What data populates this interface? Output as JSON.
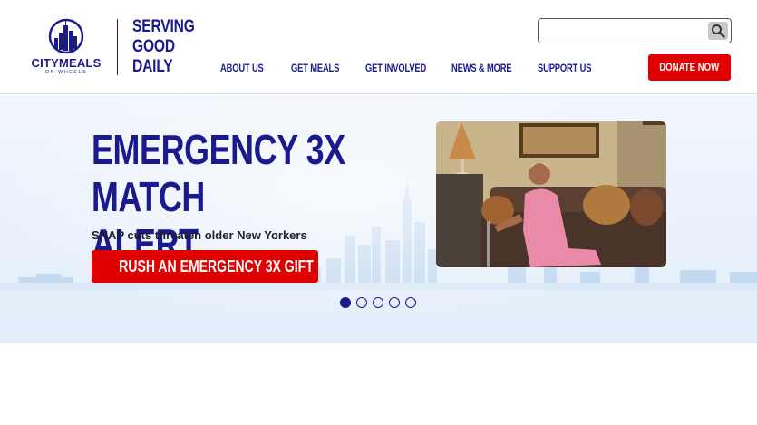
{
  "brand": {
    "logo_word": "CITYMEALS",
    "logo_sub": "ON WHEELS",
    "tagline_lines": [
      "SERVING",
      "GOOD",
      "DAILY"
    ]
  },
  "search": {
    "placeholder": "",
    "value": ""
  },
  "nav": {
    "items": [
      {
        "label": "ABOUT US"
      },
      {
        "label": "GET MEALS"
      },
      {
        "label": "GET INVOLVED"
      },
      {
        "label": "NEWS & MORE"
      },
      {
        "label": "SUPPORT US"
      }
    ],
    "donate_label": "DONATE NOW"
  },
  "hero": {
    "headline_line1": "EMERGENCY 3X MATCH",
    "headline_line2": "ALERT",
    "subhead": "SNAP cuts threaten older New Yorkers",
    "cta_label": "RUSH AN EMERGENCY 3X GIFT",
    "slides": 5,
    "active_slide": 1
  },
  "colors": {
    "brand_navy": "#1a1a8f",
    "accent_red": "#e00000",
    "hero_bg": "#e9f1fb"
  },
  "icons": {
    "logo": "city-skyline-logo-icon",
    "search": "search-icon"
  }
}
